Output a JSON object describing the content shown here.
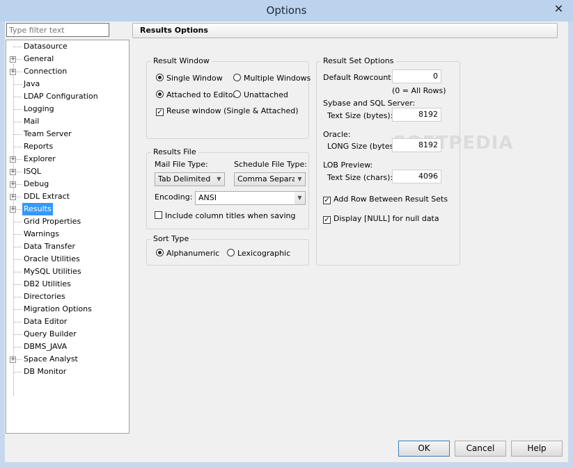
{
  "window": {
    "title": "Options",
    "close_glyph": "✕"
  },
  "filter": {
    "placeholder": "Type filter text"
  },
  "tree": {
    "items": [
      {
        "label": "Datasource",
        "expandable": false
      },
      {
        "label": "General",
        "expandable": true
      },
      {
        "label": "Connection",
        "expandable": true
      },
      {
        "label": "Java",
        "expandable": false
      },
      {
        "label": "LDAP Configuration",
        "expandable": false
      },
      {
        "label": "Logging",
        "expandable": false
      },
      {
        "label": "Mail",
        "expandable": false
      },
      {
        "label": "Team Server",
        "expandable": false
      },
      {
        "label": "Reports",
        "expandable": false
      },
      {
        "label": "Explorer",
        "expandable": true
      },
      {
        "label": "ISQL",
        "expandable": true
      },
      {
        "label": "Debug",
        "expandable": true
      },
      {
        "label": "DDL Extract",
        "expandable": true
      },
      {
        "label": "Results",
        "expandable": true,
        "selected": true
      },
      {
        "label": "Grid Properties",
        "expandable": false
      },
      {
        "label": "Warnings",
        "expandable": false
      },
      {
        "label": "Data Transfer",
        "expandable": false
      },
      {
        "label": "Oracle Utilities",
        "expandable": false
      },
      {
        "label": "MySQL Utilities",
        "expandable": false
      },
      {
        "label": "DB2 Utilities",
        "expandable": false
      },
      {
        "label": "Directories",
        "expandable": false
      },
      {
        "label": "Migration Options",
        "expandable": false
      },
      {
        "label": "Data Editor",
        "expandable": false
      },
      {
        "label": "Query Builder",
        "expandable": false
      },
      {
        "label": "DBMS_JAVA",
        "expandable": false
      },
      {
        "label": "Space Analyst",
        "expandable": true
      },
      {
        "label": "DB Monitor",
        "expandable": false
      }
    ]
  },
  "header": {
    "title": "Results Options"
  },
  "result_window": {
    "legend": "Result Window",
    "single_window": "Single Window",
    "multiple_windows": "Multiple Windows",
    "attached_to_editor": "Attached to Editor",
    "unattached": "Unattached",
    "reuse_window": "Reuse window (Single & Attached)"
  },
  "results_file": {
    "legend": "Results File",
    "mail_file_type_label": "Mail File Type:",
    "mail_file_type_value": "Tab Delimited",
    "schedule_file_type_label": "Schedule File Type:",
    "schedule_file_type_value": "Comma Separated",
    "encoding_label": "Encoding:",
    "encoding_value": "ANSI",
    "include_column_titles": "Include column titles when saving"
  },
  "sort_type": {
    "legend": "Sort Type",
    "alphanumeric": "Alphanumeric",
    "lexicographic": "Lexicographic"
  },
  "result_set_options": {
    "legend": "Result Set Options",
    "default_rowcount_label": "Default Rowcount:",
    "default_rowcount_value": "0",
    "all_rows_note": "(0 = All Rows)",
    "sybase_label": "Sybase and SQL Server:",
    "text_size_bytes_label": "Text Size (bytes):",
    "text_size_bytes_value": "8192",
    "oracle_label": "Oracle:",
    "long_size_label": "LONG Size (bytes):",
    "long_size_value": "8192",
    "lob_preview_label": "LOB Preview:",
    "text_size_chars_label": "Text Size (chars):",
    "text_size_chars_value": "4096",
    "add_row_between": "Add Row Between Result Sets",
    "display_null": "Display [NULL] for null data"
  },
  "buttons": {
    "ok": "OK",
    "cancel": "Cancel",
    "help": "Help"
  },
  "glyphs": {
    "check": "✓",
    "arrow_down": "▼",
    "expand": "+"
  }
}
